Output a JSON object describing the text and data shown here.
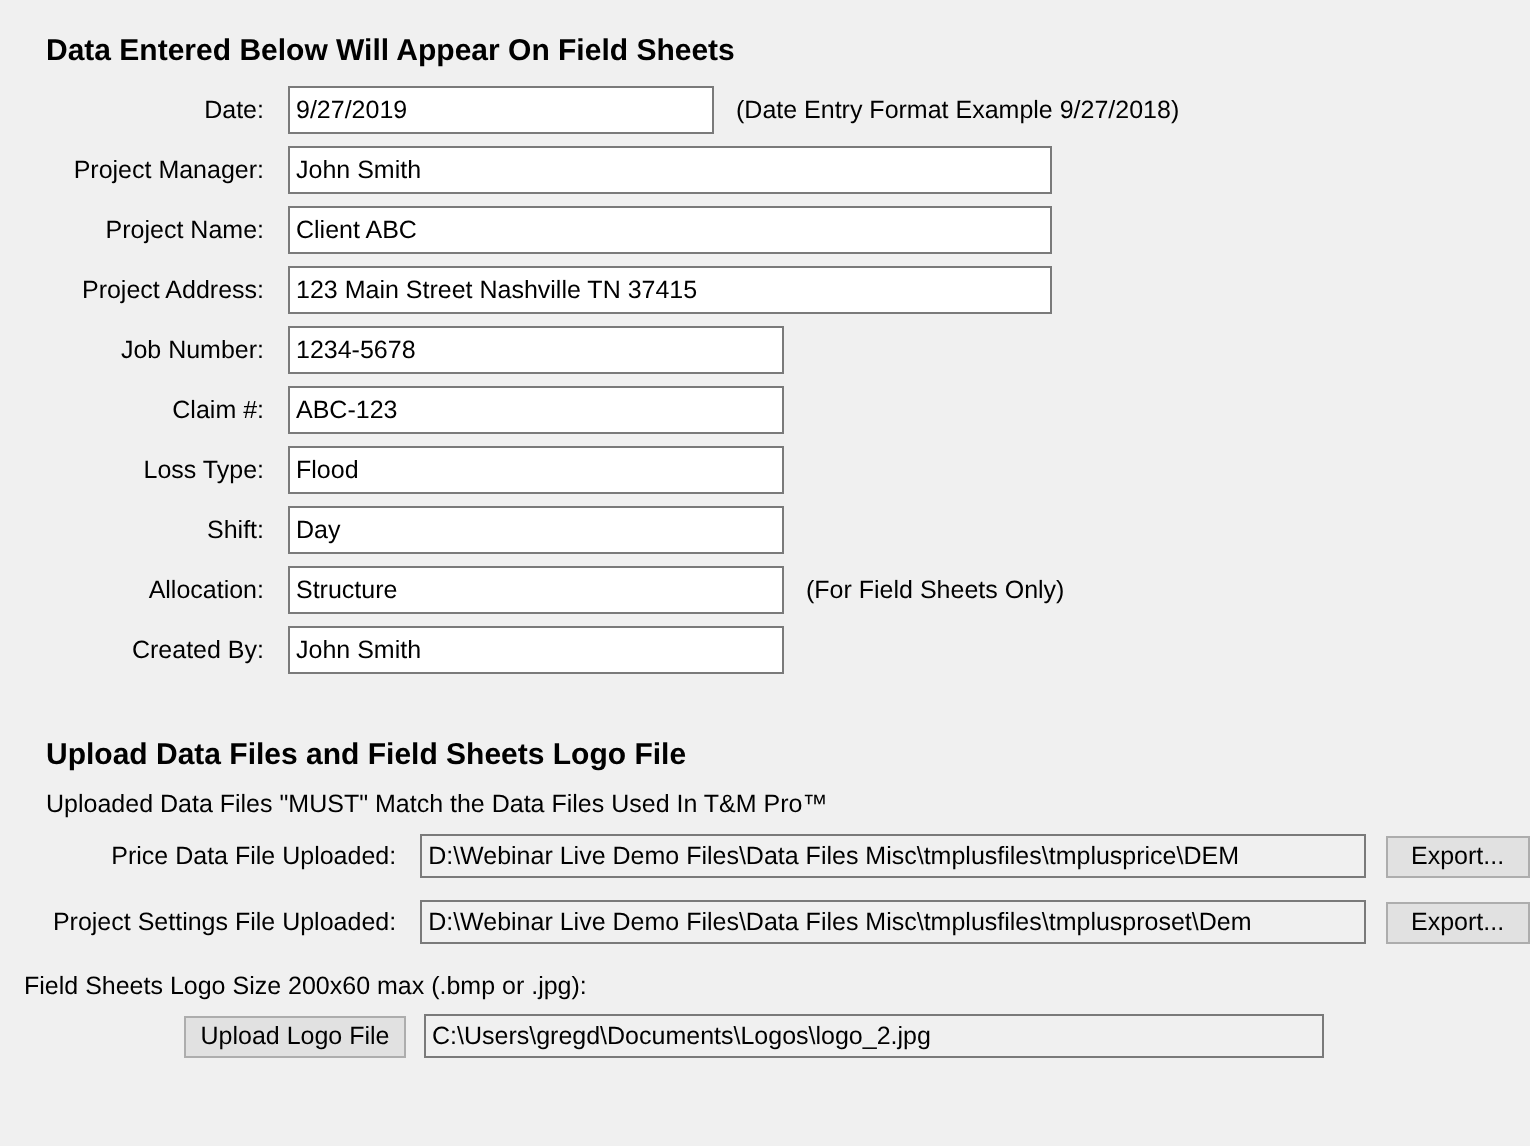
{
  "field_sheet_section": {
    "heading": "Data Entered Below Will Appear On Field Sheets",
    "fields": [
      {
        "label": "Date:",
        "value": "9/27/2019",
        "note": "(Date Entry Format Example 9/27/2018)"
      },
      {
        "label": "Project Manager:",
        "value": "John Smith"
      },
      {
        "label": "Project Name:",
        "value": "Client ABC"
      },
      {
        "label": "Project Address:",
        "value": "123 Main Street Nashville TN 37415"
      },
      {
        "label": "Job Number:",
        "value": "1234-5678"
      },
      {
        "label": "Claim #:",
        "value": "ABC-123"
      },
      {
        "label": "Loss Type:",
        "value": "Flood"
      },
      {
        "label": "Shift:",
        "value": "Day"
      },
      {
        "label": "Allocation:",
        "value": "Structure",
        "note": "(For Field Sheets Only)"
      },
      {
        "label": "Created By:",
        "value": "John Smith"
      }
    ]
  },
  "upload_section": {
    "heading": "Upload Data Files and Field Sheets Logo File",
    "notice": "Uploaded Data Files \"MUST\" Match the Data Files Used In T&M Pro™",
    "files": [
      {
        "label": "Price Data File Uploaded:",
        "value": "D:\\Webinar Live Demo Files\\Data Files Misc\\tmplusfiles\\tmplusprice\\DEM",
        "button": "Export..."
      },
      {
        "label": "Project Settings File Uploaded:",
        "value": "D:\\Webinar Live Demo Files\\Data Files Misc\\tmplusfiles\\tmplusproset\\Dem",
        "button": "Export..."
      }
    ],
    "logo_hint": "Field Sheets Logo Size 200x60 max (.bmp or .jpg):",
    "logo_button": "Upload Logo File",
    "logo_path": "C:\\Users\\gregd\\Documents\\Logos\\logo_2.jpg"
  }
}
